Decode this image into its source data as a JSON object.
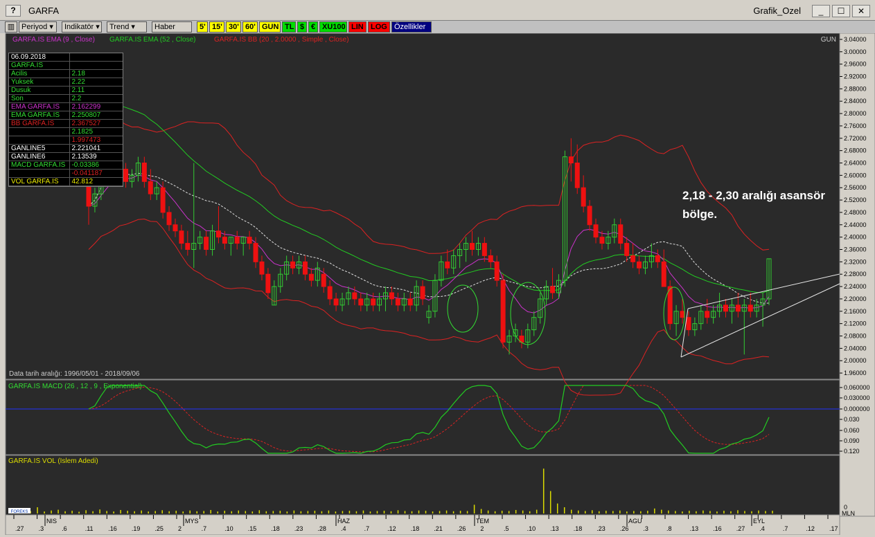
{
  "window": {
    "help_label": "?",
    "title": "GARFA",
    "right_title": "Grafik_Ozel",
    "minimize": "_",
    "maximize": "☐",
    "close": "✕"
  },
  "toolbar": {
    "items": [
      {
        "label": "Periyod ▾",
        "style": "menu"
      },
      {
        "label": "Indikatör ▾",
        "style": "menu"
      },
      {
        "label": "Trend ▾",
        "style": "menu"
      },
      {
        "label": "Haber",
        "style": "menu"
      },
      {
        "label": "5'",
        "style": "yellow"
      },
      {
        "label": "15'",
        "style": "yellow"
      },
      {
        "label": "30'",
        "style": "yellow"
      },
      {
        "label": "60'",
        "style": "yellow"
      },
      {
        "label": "GUN",
        "style": "yellow"
      },
      {
        "label": "TL",
        "style": "green"
      },
      {
        "label": "$",
        "style": "green"
      },
      {
        "label": "€",
        "style": "green"
      },
      {
        "label": "XU100",
        "style": "green"
      },
      {
        "label": "LIN",
        "style": "red"
      },
      {
        "label": "LOG",
        "style": "red"
      },
      {
        "label": "Özellikler",
        "style": "blue"
      }
    ]
  },
  "colors": {
    "background": "#2a2a2a",
    "ema9": "#cc33cc",
    "ema52": "#22cc22",
    "bollinger": "#dd2222",
    "candle_up": "#33cc33",
    "candle_down": "#ee1111",
    "macd": "#22cc22",
    "signal": "#dd2222",
    "volume": "#dddd00",
    "ganline": "#e8e8e8"
  },
  "main_chart": {
    "legend_ema9": "GARFA.IS EMA (9 , Close)",
    "legend_ema52": "GARFA.IS EMA (52 , Close)",
    "legend_bb": "GARFA.IS BB (20 , 2.0000 , Simple , Close)",
    "period_label": "GUN",
    "date_range": "Data tarih aralığı:  1996/05/01 - 2018/09/06",
    "annotation_line1": "2,18 - 2,30 aralığı asansör",
    "annotation_line2": "bölge."
  },
  "info_box": [
    {
      "k": "06.09.2018",
      "v": "",
      "kc": "#ffffff",
      "vc": "#ffffff"
    },
    {
      "k": "GARFA.IS",
      "v": "",
      "kc": "#33dd33",
      "vc": "#33dd33"
    },
    {
      "k": " Acilis",
      "v": "2.18",
      "kc": "#33dd33",
      "vc": "#33dd33"
    },
    {
      "k": " Yuksek",
      "v": "2.22",
      "kc": "#33dd33",
      "vc": "#33dd33"
    },
    {
      "k": " Dusuk",
      "v": "2.11",
      "kc": "#33dd33",
      "vc": "#33dd33"
    },
    {
      "k": " Son",
      "v": "2.2",
      "kc": "#33dd33",
      "vc": "#33dd33"
    },
    {
      "k": "EMA GARFA.IS",
      "v": "2.162299",
      "kc": "#cc33cc",
      "vc": "#cc33cc"
    },
    {
      "k": "EMA GARFA.IS",
      "v": "2.250807",
      "kc": "#33dd33",
      "vc": "#33dd33"
    },
    {
      "k": "BB GARFA.IS",
      "v": "2.367527",
      "kc": "#dd2222",
      "vc": "#dd2222"
    },
    {
      "k": "",
      "v": "2.1825",
      "kc": "#33dd33",
      "vc": "#33dd33"
    },
    {
      "k": "",
      "v": "1.997473",
      "kc": "#dd2222",
      "vc": "#dd2222"
    },
    {
      "k": "GANLINE5",
      "v": "2.221041",
      "kc": "#ffffff",
      "vc": "#ffffff"
    },
    {
      "k": "GANLINE6",
      "v": "2.13539",
      "kc": "#ffffff",
      "vc": "#ffffff"
    },
    {
      "k": "MACD GARFA.IS",
      "v": "-0.03386",
      "kc": "#33dd33",
      "vc": "#33dd33"
    },
    {
      "k": "",
      "v": "-0.041187",
      "kc": "#dd2222",
      "vc": "#dd2222"
    },
    {
      "k": "VOL GARFA.IS",
      "v": "42.812",
      "kc": "#eeee00",
      "vc": "#eeee00"
    }
  ],
  "macd_panel": {
    "legend": "GARFA.IS MACD (26 , 12 , 9 , Exponential)"
  },
  "volume_panel": {
    "legend": "GARFA.IS VOL (Islem Adedi)",
    "axis_label": "MLN",
    "axis_zero": "0",
    "logo": "FOREKS"
  },
  "chart_data": {
    "type": "candlestick",
    "title": "",
    "x_ticks_top": [
      "NIS",
      "MYS",
      "HAZ",
      "TEM",
      "AGU",
      "EYL"
    ],
    "x_ticks_days": [
      ".27",
      ".3",
      ".6",
      ".11",
      ".16",
      ".19",
      ".25",
      "2",
      ".7",
      ".10",
      ".15",
      ".18",
      ".23",
      ".28",
      ".4",
      ".7",
      ".12",
      ".18",
      ".21",
      ".26",
      "2",
      ".5",
      ".10",
      ".13",
      ".18",
      ".23",
      ".26",
      ".3",
      ".8",
      ".13",
      ".16",
      ".27",
      ".4",
      ".7",
      ".12",
      ".17"
    ],
    "y_ticks": [
      "3.04000",
      "3.00000",
      "2.96000",
      "2.92000",
      "2.88000",
      "2.84000",
      "2.80000",
      "2.76000",
      "2.72000",
      "2.68000",
      "2.64000",
      "2.60000",
      "2.56000",
      "2.52000",
      "2.48000",
      "2.44000",
      "2.40000",
      "2.36000",
      "2.32000",
      "2.28000",
      "2.24000",
      "2.20000",
      "2.16000",
      "2.12000",
      "2.08000",
      "2.04000",
      "2.00000",
      "1.96000"
    ],
    "y_range": [
      1.94,
      3.06
    ],
    "candles": [
      [
        2.58,
        2.64,
        2.44,
        2.5
      ],
      [
        2.5,
        2.56,
        2.48,
        2.54
      ],
      [
        2.54,
        2.66,
        2.52,
        2.64
      ],
      [
        2.64,
        2.7,
        2.6,
        2.66
      ],
      [
        2.66,
        2.72,
        2.62,
        2.68
      ],
      [
        2.68,
        2.7,
        2.6,
        2.62
      ],
      [
        2.62,
        2.64,
        2.56,
        2.58
      ],
      [
        2.58,
        2.62,
        2.56,
        2.6
      ],
      [
        2.6,
        2.66,
        2.58,
        2.64
      ],
      [
        2.64,
        2.66,
        2.56,
        2.58
      ],
      [
        2.58,
        2.62,
        2.52,
        2.54
      ],
      [
        2.54,
        2.58,
        2.52,
        2.56
      ],
      [
        2.56,
        2.58,
        2.46,
        2.48
      ],
      [
        2.48,
        2.5,
        2.42,
        2.44
      ],
      [
        2.44,
        2.46,
        2.4,
        2.42
      ],
      [
        2.42,
        2.44,
        2.36,
        2.38
      ],
      [
        2.38,
        2.42,
        2.34,
        2.36
      ],
      [
        2.36,
        2.64,
        2.3,
        2.38
      ],
      [
        2.38,
        2.42,
        2.36,
        2.4
      ],
      [
        2.4,
        2.42,
        2.34,
        2.36
      ],
      [
        2.36,
        2.44,
        2.34,
        2.42
      ],
      [
        2.42,
        2.5,
        2.38,
        2.4
      ],
      [
        2.4,
        2.42,
        2.36,
        2.38
      ],
      [
        2.38,
        2.4,
        2.34,
        2.4
      ],
      [
        2.4,
        2.42,
        2.36,
        2.38
      ],
      [
        2.38,
        2.4,
        2.34,
        2.4
      ],
      [
        2.4,
        2.42,
        2.36,
        2.38
      ],
      [
        2.38,
        2.4,
        2.3,
        2.32
      ],
      [
        2.32,
        2.34,
        2.26,
        2.28
      ],
      [
        2.28,
        2.3,
        2.2,
        2.22
      ],
      [
        2.18,
        2.26,
        2.18,
        2.24
      ],
      [
        2.24,
        2.3,
        2.22,
        2.28
      ],
      [
        2.28,
        2.34,
        2.26,
        2.32
      ],
      [
        2.32,
        2.34,
        2.28,
        2.3
      ],
      [
        2.3,
        2.34,
        2.28,
        2.32
      ],
      [
        2.32,
        2.34,
        2.26,
        2.28
      ],
      [
        2.28,
        2.3,
        2.24,
        2.26
      ],
      [
        2.26,
        2.32,
        2.24,
        2.3
      ],
      [
        2.28,
        2.3,
        2.22,
        2.24
      ],
      [
        2.24,
        2.26,
        2.18,
        2.2
      ],
      [
        2.2,
        2.22,
        2.16,
        2.18
      ],
      [
        2.18,
        2.22,
        2.16,
        2.2
      ],
      [
        2.2,
        2.24,
        2.18,
        2.22
      ],
      [
        2.22,
        2.24,
        2.18,
        2.2
      ],
      [
        2.2,
        2.22,
        2.16,
        2.18
      ],
      [
        2.18,
        2.22,
        2.16,
        2.2
      ],
      [
        2.2,
        2.22,
        2.16,
        2.18
      ],
      [
        2.18,
        2.22,
        2.16,
        2.2
      ],
      [
        2.2,
        2.24,
        2.16,
        2.22
      ],
      [
        2.22,
        2.24,
        2.18,
        2.2
      ],
      [
        2.2,
        2.22,
        2.16,
        2.18
      ],
      [
        2.18,
        2.22,
        2.16,
        2.2
      ],
      [
        2.2,
        2.22,
        2.16,
        2.18
      ],
      [
        2.18,
        2.26,
        2.16,
        2.24
      ],
      [
        2.24,
        2.26,
        2.18,
        2.2
      ],
      [
        2.14,
        2.18,
        2.12,
        2.16
      ],
      [
        2.16,
        2.28,
        2.14,
        2.26
      ],
      [
        2.26,
        2.34,
        2.24,
        2.32
      ],
      [
        2.32,
        2.36,
        2.28,
        2.3
      ],
      [
        2.3,
        2.36,
        2.28,
        2.34
      ],
      [
        2.34,
        2.38,
        2.3,
        2.36
      ],
      [
        2.36,
        2.4,
        2.32,
        2.38
      ],
      [
        2.38,
        2.42,
        2.34,
        2.36
      ],
      [
        2.36,
        2.4,
        2.34,
        2.38
      ],
      [
        2.38,
        2.4,
        2.32,
        2.34
      ],
      [
        2.34,
        2.36,
        2.3,
        2.32
      ],
      [
        2.32,
        2.34,
        2.24,
        2.26
      ],
      [
        2.26,
        2.28,
        2.04,
        2.06
      ],
      [
        2.06,
        2.1,
        2.02,
        2.08
      ],
      [
        2.08,
        2.12,
        2.06,
        2.1
      ],
      [
        2.08,
        2.1,
        2.04,
        2.06
      ],
      [
        2.06,
        2.12,
        2.04,
        2.1
      ],
      [
        2.1,
        2.16,
        2.08,
        2.14
      ],
      [
        2.14,
        2.22,
        2.12,
        2.2
      ],
      [
        2.2,
        2.26,
        2.18,
        2.24
      ],
      [
        2.24,
        2.3,
        2.2,
        2.22
      ],
      [
        2.22,
        2.28,
        2.2,
        2.26
      ],
      [
        2.26,
        2.68,
        2.24,
        2.66
      ],
      [
        2.66,
        2.72,
        2.58,
        2.64
      ],
      [
        2.64,
        2.7,
        2.54,
        2.56
      ],
      [
        2.56,
        2.6,
        2.48,
        2.5
      ],
      [
        2.5,
        2.52,
        2.42,
        2.44
      ],
      [
        2.44,
        2.46,
        2.38,
        2.4
      ],
      [
        2.4,
        2.42,
        2.36,
        2.38
      ],
      [
        2.38,
        2.42,
        2.36,
        2.4
      ],
      [
        2.4,
        2.46,
        2.38,
        2.44
      ],
      [
        2.44,
        2.46,
        2.36,
        2.38
      ],
      [
        2.38,
        2.4,
        2.32,
        2.34
      ],
      [
        2.34,
        2.38,
        2.3,
        2.32
      ],
      [
        2.32,
        2.34,
        2.28,
        2.3
      ],
      [
        2.3,
        2.34,
        2.28,
        2.32
      ],
      [
        2.32,
        2.38,
        2.3,
        2.34
      ],
      [
        2.34,
        2.36,
        2.3,
        2.32
      ],
      [
        2.32,
        2.36,
        2.28,
        2.24
      ],
      [
        2.24,
        2.26,
        2.1,
        2.12
      ],
      [
        2.12,
        2.18,
        2.08,
        2.16
      ],
      [
        2.16,
        2.2,
        2.12,
        2.14
      ],
      [
        2.14,
        2.16,
        2.08,
        2.1
      ],
      [
        2.1,
        2.14,
        2.08,
        2.12
      ],
      [
        2.12,
        2.18,
        2.1,
        2.16
      ],
      [
        2.16,
        2.2,
        2.12,
        2.14
      ],
      [
        2.14,
        2.18,
        2.12,
        2.16
      ],
      [
        2.16,
        2.22,
        2.14,
        2.18
      ],
      [
        2.18,
        2.2,
        2.14,
        2.16
      ],
      [
        2.16,
        2.2,
        2.12,
        2.18
      ],
      [
        2.18,
        2.22,
        2.14,
        2.16
      ],
      [
        2.16,
        2.2,
        2.02,
        2.18
      ],
      [
        2.18,
        2.22,
        2.14,
        2.16
      ],
      [
        2.16,
        2.2,
        2.14,
        2.18
      ],
      [
        2.18,
        2.22,
        2.11,
        2.2
      ],
      [
        2.2,
        2.33,
        2.18,
        2.33
      ]
    ],
    "macd_y_ticks": [
      "0.060000",
      "0.030000",
      "0.000000",
      "0.030",
      "0.060",
      "0.090",
      "0.120"
    ],
    "volume_values": [
      1.5,
      1.2,
      1.8,
      1.0,
      2.5,
      0.8,
      1.2,
      1.5,
      0.9,
      1.1,
      0.7,
      1.3,
      0.9,
      1.6,
      1.0,
      0.8,
      1.4,
      1.1,
      0.9,
      1.2,
      0.8,
      1.0,
      1.3,
      0.9,
      1.1,
      0.8,
      1.2,
      0.9,
      1.0,
      1.4,
      0.8,
      1.1,
      0.9,
      1.2,
      1.0,
      0.8,
      1.3,
      0.9,
      1.0,
      1.1,
      0.8,
      1.2,
      0.9,
      1.0,
      1.1,
      0.9,
      1.2,
      0.8,
      1.0,
      1.1,
      0.9,
      1.2,
      0.8,
      1.0,
      1.1,
      0.9,
      1.3,
      1.0,
      0.9,
      1.2,
      1.1,
      0.8,
      1.0,
      1.2,
      0.9,
      1.1,
      1.0,
      3.5,
      1.8,
      1.2,
      0.9,
      1.1,
      1.0,
      1.4,
      1.2,
      0.9,
      1.5,
      18,
      9,
      4,
      2.5,
      1.5,
      1.2,
      1.0,
      1.3,
      0.9,
      1.1,
      1.0,
      1.2,
      0.8,
      1.0,
      0.9,
      1.1,
      2.0,
      1.5,
      1.2,
      1.0,
      0.8,
      1.1,
      0.9,
      1.2,
      1.0,
      0.8,
      1.1,
      0.9,
      1.3,
      1.0,
      0.9,
      1.2,
      1.0,
      1.1
    ]
  }
}
